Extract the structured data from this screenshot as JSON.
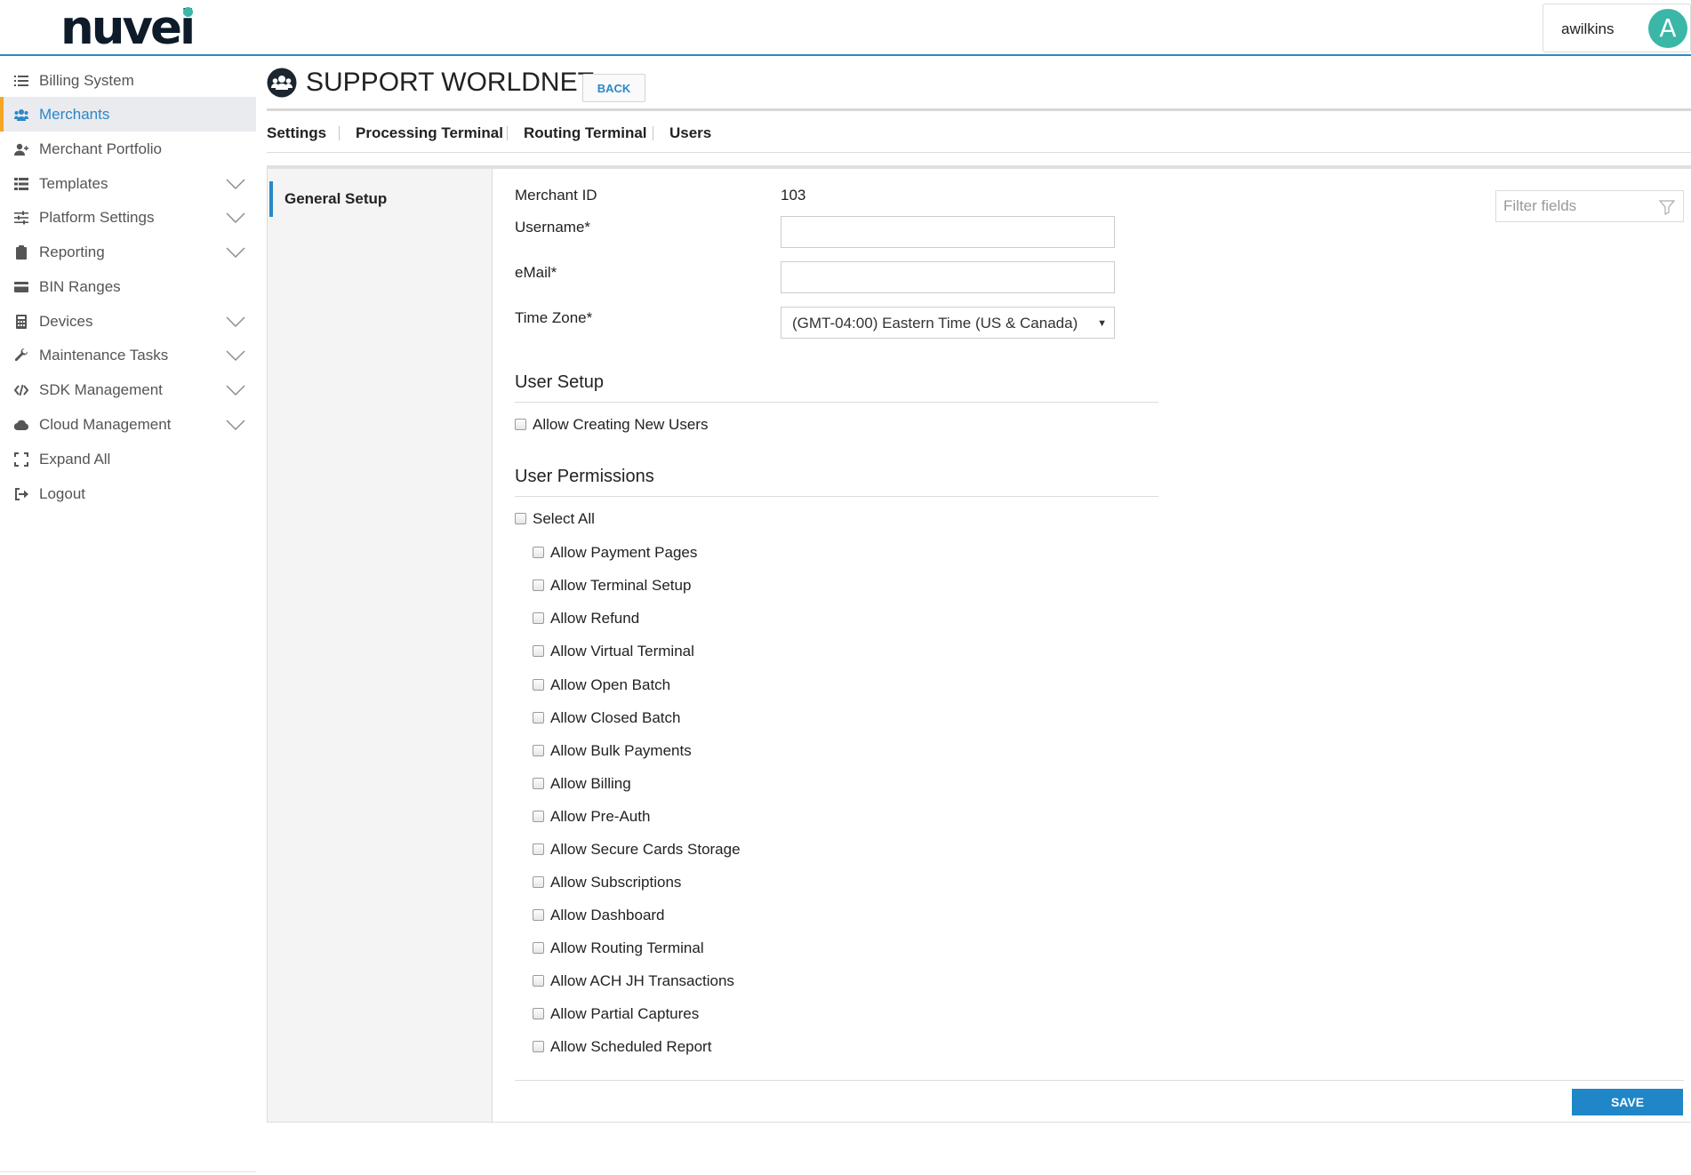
{
  "brand": {
    "name": "nuvei",
    "accent": "#2b88c8",
    "highlight": "#f5a623",
    "logo_dot": "#3ab7a6"
  },
  "user": {
    "name": "awilkins",
    "initial": "A"
  },
  "sidebar": {
    "items": [
      {
        "label": "Billing System",
        "icon": "list-icon",
        "expandable": false,
        "active": false
      },
      {
        "label": "Merchants",
        "icon": "users-icon",
        "expandable": false,
        "active": true
      },
      {
        "label": "Merchant Portfolio",
        "icon": "user-plus-icon",
        "expandable": false,
        "active": false
      },
      {
        "label": "Templates",
        "icon": "table-list-icon",
        "expandable": true,
        "active": false
      },
      {
        "label": "Platform Settings",
        "icon": "sliders-icon",
        "expandable": true,
        "active": false
      },
      {
        "label": "Reporting",
        "icon": "clipboard-icon",
        "expandable": true,
        "active": false
      },
      {
        "label": "BIN Ranges",
        "icon": "card-icon",
        "expandable": false,
        "active": false
      },
      {
        "label": "Devices",
        "icon": "calculator-icon",
        "expandable": true,
        "active": false
      },
      {
        "label": "Maintenance Tasks",
        "icon": "wrench-icon",
        "expandable": true,
        "active": false
      },
      {
        "label": "SDK Management",
        "icon": "code-icon",
        "expandable": true,
        "active": false
      },
      {
        "label": "Cloud Management",
        "icon": "cloud-icon",
        "expandable": true,
        "active": false
      },
      {
        "label": "Expand All",
        "icon": "expand-icon",
        "expandable": false,
        "active": false
      },
      {
        "label": "Logout",
        "icon": "logout-icon",
        "expandable": false,
        "active": false
      }
    ]
  },
  "header": {
    "title": "SUPPORT WORLDNET",
    "back_label": "BACK"
  },
  "tabs": [
    "Settings",
    "Processing Terminal",
    "Routing Terminal",
    "Users"
  ],
  "left_panel": {
    "item": "General Setup"
  },
  "form": {
    "merchant_id_label": "Merchant ID",
    "merchant_id_value": "103",
    "username_label": "Username*",
    "username_value": "",
    "email_label": "eMail*",
    "email_value": "",
    "timezone_label": "Time Zone*",
    "timezone_value": "(GMT-04:00) Eastern Time (US & Canada)"
  },
  "filter": {
    "placeholder": "Filter fields"
  },
  "user_setup": {
    "title": "User Setup",
    "allow_creating": "Allow Creating New Users"
  },
  "permissions": {
    "title": "User Permissions",
    "select_all": "Select All",
    "items": [
      "Allow Payment Pages",
      "Allow Terminal Setup",
      "Allow Refund",
      "Allow Virtual Terminal",
      "Allow Open Batch",
      "Allow Closed Batch",
      "Allow Bulk Payments",
      "Allow Billing",
      "Allow Pre-Auth",
      "Allow Secure Cards Storage",
      "Allow Subscriptions",
      "Allow Dashboard",
      "Allow Routing Terminal",
      "Allow ACH JH Transactions",
      "Allow Partial Captures",
      "Allow Scheduled Report"
    ]
  },
  "actions": {
    "save_label": "SAVE"
  }
}
